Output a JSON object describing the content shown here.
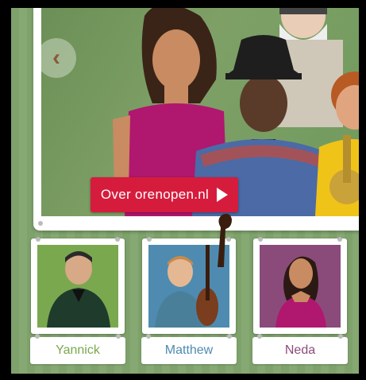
{
  "hero": {
    "cta_label": "Over orenopen.nl",
    "prev_icon": "chevron-left-icon"
  },
  "musicians": [
    {
      "name": "Yannick",
      "color": "#7aa84f"
    },
    {
      "name": "Matthew",
      "color": "#4f8bb0"
    },
    {
      "name": "Neda",
      "color": "#8a4b7a"
    }
  ],
  "colors": {
    "accent": "#d61c3c",
    "background": "#7fa26c"
  }
}
